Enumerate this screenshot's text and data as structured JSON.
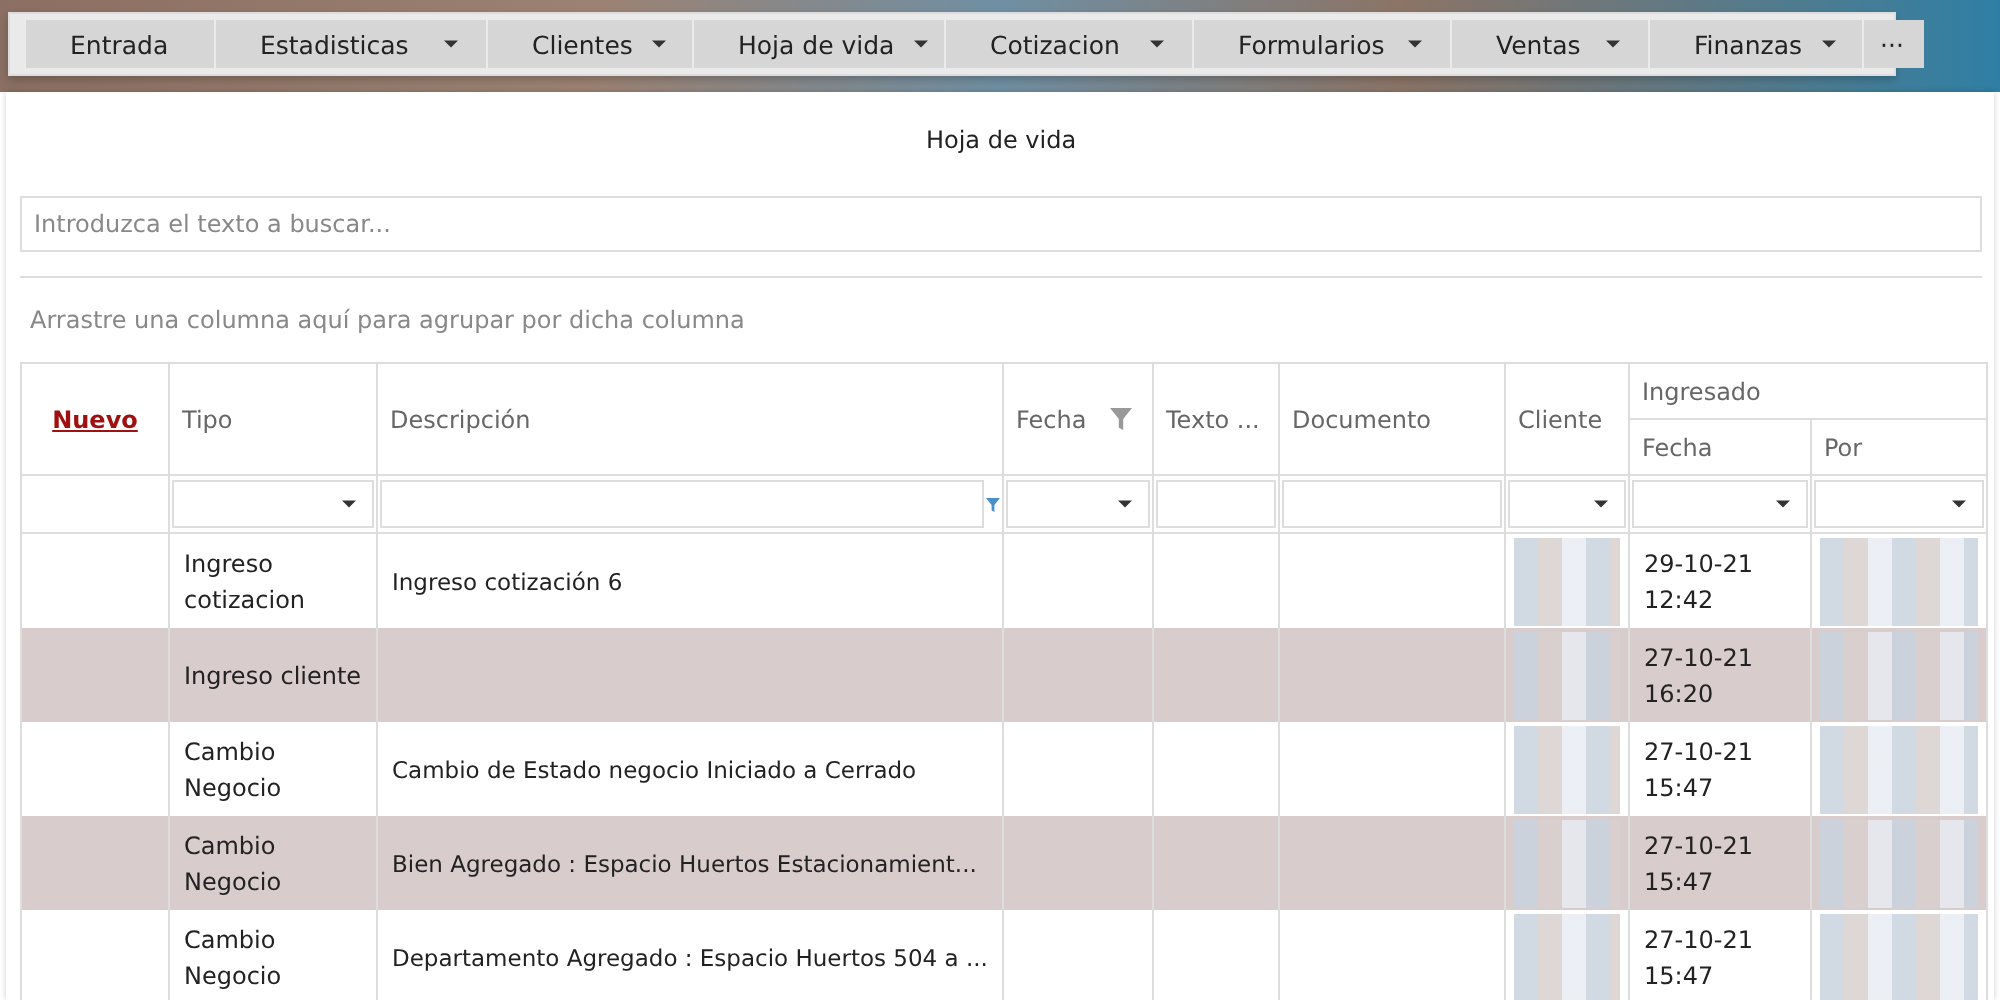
{
  "menu": [
    {
      "label": "Entrada",
      "dropdown": false
    },
    {
      "label": "Estadisticas",
      "dropdown": true
    },
    {
      "label": "Clientes",
      "dropdown": true
    },
    {
      "label": "Hoja de vida",
      "dropdown": true
    },
    {
      "label": "Cotizacion",
      "dropdown": true
    },
    {
      "label": "Formularios",
      "dropdown": true
    },
    {
      "label": "Ventas",
      "dropdown": true
    },
    {
      "label": "Finanzas",
      "dropdown": true
    },
    {
      "label": "···",
      "dropdown": false
    }
  ],
  "page_title": "Hoja de vida",
  "search": {
    "placeholder": "Introduzca el texto a buscar..."
  },
  "group_hint": "Arrastre una columna aquí para agrupar por dicha columna",
  "table": {
    "new_link": "Nuevo",
    "columns": [
      {
        "label": "Tipo",
        "filter_icon": false
      },
      {
        "label": "Descripción",
        "filter_icon": false
      },
      {
        "label": "Fecha",
        "filter_icon": true
      },
      {
        "label": "Texto ...",
        "filter_icon": false
      },
      {
        "label": "Documento",
        "filter_icon": false
      },
      {
        "label": "Cliente",
        "filter_icon": false
      }
    ],
    "group": {
      "label": "Ingresado",
      "columns": [
        {
          "label": "Fecha"
        },
        {
          "label": "Por"
        }
      ]
    },
    "filters": [
      {
        "kind": "dropdown"
      },
      {
        "kind": "text"
      },
      {
        "kind": "dropdown"
      },
      {
        "kind": "field"
      },
      {
        "kind": "field"
      },
      {
        "kind": "dropdown"
      },
      {
        "kind": "dropdown"
      },
      {
        "kind": "dropdown"
      }
    ],
    "rows": [
      {
        "tipo": "Ingreso cotizacion",
        "descripcion": "Ingreso cotización 6",
        "fecha": "29-10-21 12:42"
      },
      {
        "tipo": "Ingreso cliente",
        "fecha": "27-10-21 16:20"
      },
      {
        "tipo": "Cambio Negocio",
        "descripcion": "Cambio de Estado negocio Iniciado a Cerrado",
        "fecha": "27-10-21 15:47"
      },
      {
        "tipo": "Cambio Negocio",
        "descripcion": "Bien Agregado : Espacio Huertos Estacionamient...",
        "fecha": "27-10-21 15:47"
      },
      {
        "tipo": "Cambio Negocio",
        "descripcion": "Departamento Agregado : Espacio Huertos 504 a ...",
        "fecha": "27-10-21 15:47"
      }
    ]
  }
}
